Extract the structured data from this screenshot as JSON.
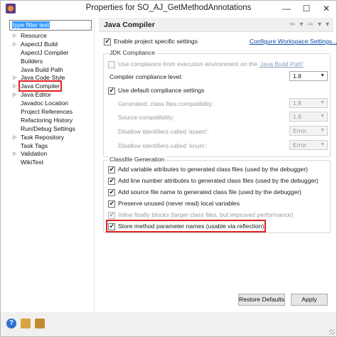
{
  "window": {
    "title": "Properties for SO_AJ_GetMethodAnnotations",
    "minimize": "—",
    "maximize": "☐",
    "close": "✕"
  },
  "left": {
    "filter_text": "type filter text",
    "items": [
      {
        "label": "Resource",
        "expandable": true
      },
      {
        "label": "AspectJ Build",
        "expandable": true
      },
      {
        "label": "AspectJ Compiler",
        "expandable": false
      },
      {
        "label": "Builders",
        "expandable": false
      },
      {
        "label": "Java Build Path",
        "expandable": false
      },
      {
        "label": "Java Code Style",
        "expandable": true
      },
      {
        "label": "Java Compiler",
        "expandable": true,
        "selected": true
      },
      {
        "label": "Java Editor",
        "expandable": true
      },
      {
        "label": "Javadoc Location",
        "expandable": false
      },
      {
        "label": "Project References",
        "expandable": false
      },
      {
        "label": "Refactoring History",
        "expandable": false
      },
      {
        "label": "Run/Debug Settings",
        "expandable": false
      },
      {
        "label": "Task Repository",
        "expandable": true
      },
      {
        "label": "Task Tags",
        "expandable": false
      },
      {
        "label": "Validation",
        "expandable": true
      },
      {
        "label": "WikiText",
        "expandable": false
      }
    ]
  },
  "right": {
    "title": "Java Compiler",
    "nav": {
      "back": "⇦",
      "back_menu": "▾",
      "forward": "⇨",
      "forward_menu": "▾",
      "menu": "▾"
    },
    "enable_specific": "Enable project specific settings",
    "configure_link": "Configure Workspace Settings...",
    "jdk": {
      "group_title": "JDK Compliance",
      "use_exec_env": "Use compliance from execution environment on the ",
      "exec_env_link": "'Java Build Path'",
      "compliance_label": "Compiler compliance level:",
      "compliance_value": "1.8",
      "use_default": "Use default compliance settings",
      "generated_label": "Generated .class files compatibility:",
      "generated_value": "1.8",
      "source_label": "Source compatibility:",
      "source_value": "1.8",
      "assert_label": "Disallow identifiers called 'assert':",
      "assert_value": "Error",
      "enum_label": "Disallow identifiers called 'enum':",
      "enum_value": "Error"
    },
    "classfile": {
      "group_title": "Classfile Generation",
      "opt1": "Add variable attributes to generated class files (used by the debugger)",
      "opt2": "Add line number attributes to generated class files (used by the debugger)",
      "opt3": "Add source file name to generated class file (used by the debugger)",
      "opt4": "Preserve unused (never read) local variables",
      "opt5": "Inline finally blocks (larger class files, but improved performance)",
      "opt6": "Store method parameter names (usable via reflection)"
    },
    "restore_defaults": "Restore Defaults",
    "apply": "Apply"
  },
  "footer": {
    "help": "?"
  }
}
